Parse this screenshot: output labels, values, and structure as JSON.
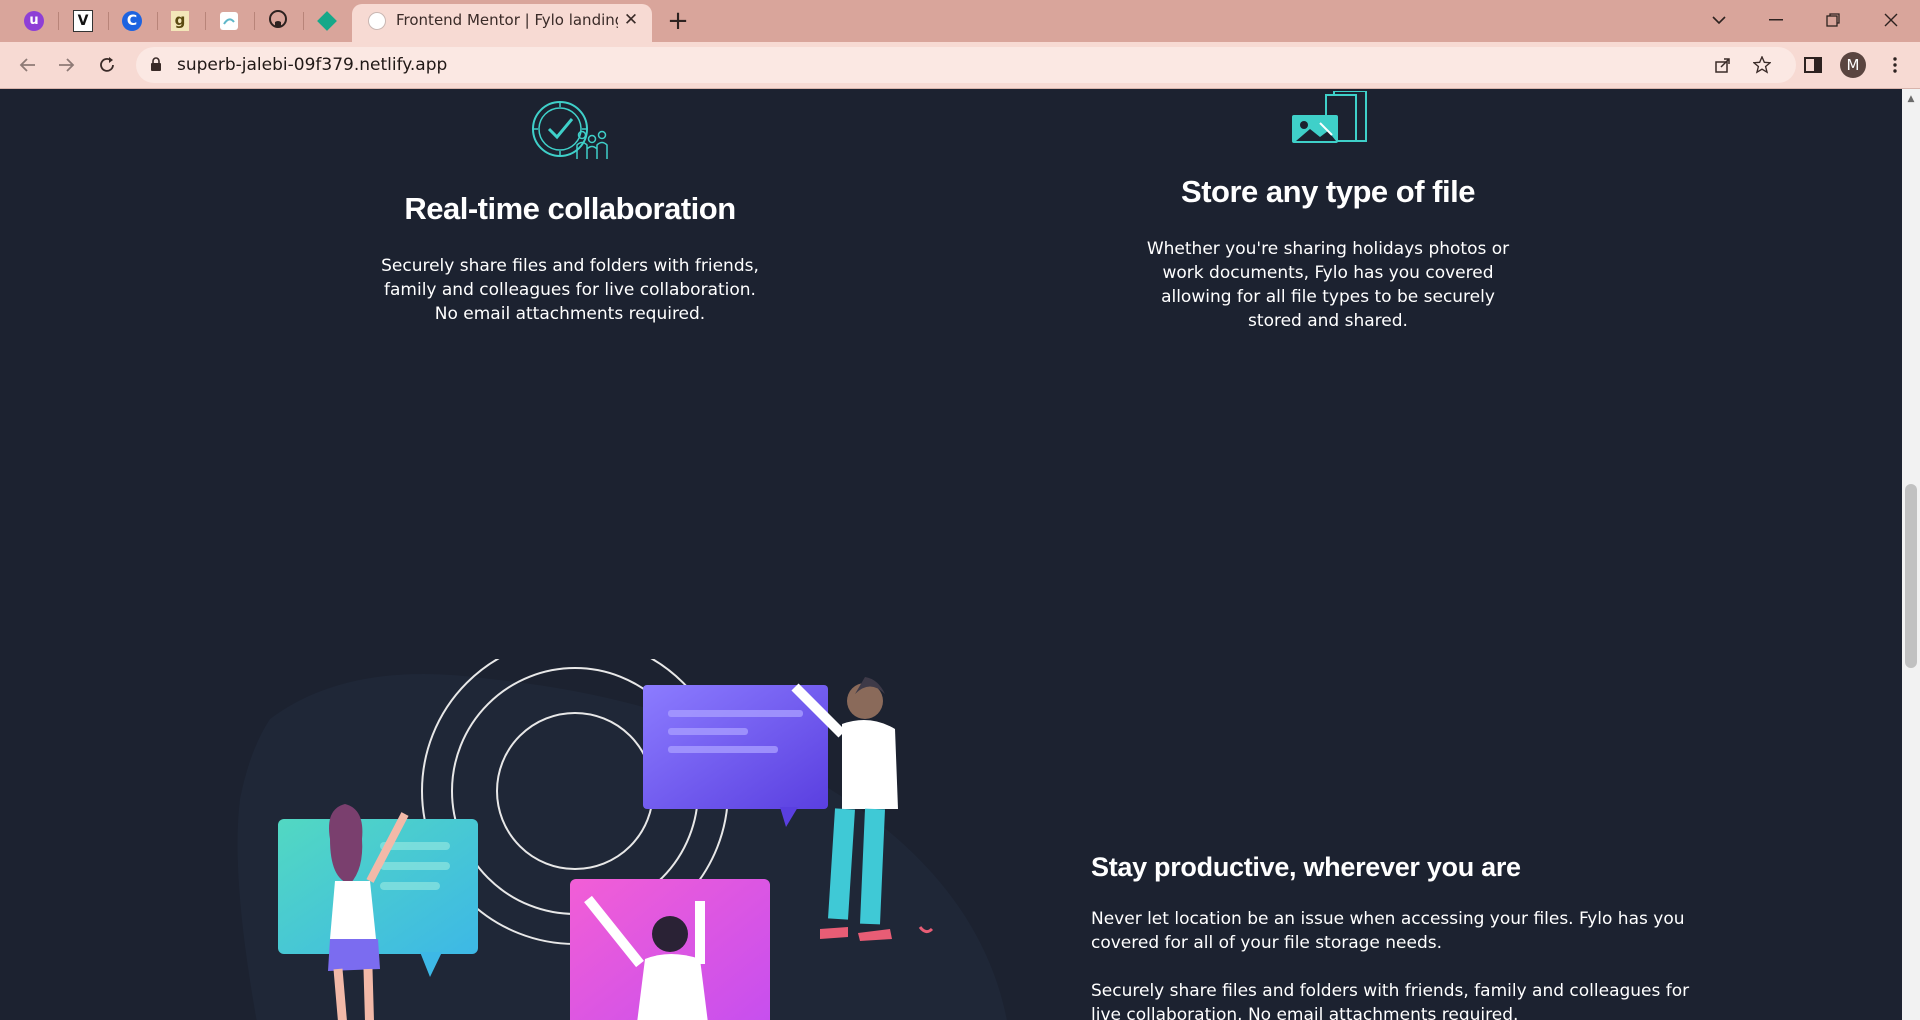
{
  "browser": {
    "pinned_tabs": [
      {
        "name": "pinned-tab-1",
        "icon": "u-icon",
        "glyph": "u"
      },
      {
        "name": "pinned-tab-2",
        "icon": "v-icon",
        "glyph": "V"
      },
      {
        "name": "pinned-tab-3",
        "icon": "c-icon",
        "glyph": "C"
      },
      {
        "name": "pinned-tab-4",
        "icon": "g-icon",
        "glyph": "g"
      },
      {
        "name": "pinned-tab-5",
        "icon": "fylo-icon",
        "glyph": ""
      },
      {
        "name": "pinned-tab-6",
        "icon": "github-icon",
        "glyph": ""
      },
      {
        "name": "pinned-tab-7",
        "icon": "diamond-icon",
        "glyph": ""
      }
    ],
    "active_tab_title": "Frontend Mentor | Fylo landing p",
    "tab_close": "✕",
    "new_tab": "+",
    "url": "superb-jalebi-09f379.netlify.app",
    "profile_initial": "M",
    "colors": {
      "tabbar": "#d9a59b",
      "toolbar": "#f7dad3"
    }
  },
  "page": {
    "features": [
      {
        "title": "Real-time collaboration",
        "text": "Securely share files and folders with friends, family and colleagues for live collaboration. No email attachments required.",
        "icon": "collaboration-icon"
      },
      {
        "title": "Store any type of file",
        "text": "Whether you're sharing holidays photos or work documents, Fylo has you covered allowing for all file types to be securely stored and shared.",
        "icon": "store-files-icon"
      }
    ],
    "productive": {
      "title": "Stay productive, wherever you are",
      "paragraph1": "Never let location be an issue when accessing your files. Fylo has you covered for all of your file storage needs.",
      "paragraph2": "Securely share files and folders with friends, family and colleagues for live collaboration. No email attachments required."
    },
    "colors": {
      "background": "#1c2230",
      "accent": "#3fd0c9",
      "text": "#ffffff"
    }
  }
}
